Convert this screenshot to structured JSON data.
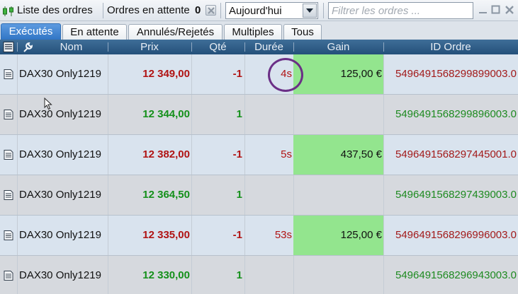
{
  "toolbar": {
    "title": "Liste des ordres",
    "pending_label": "Ordres en attente",
    "pending_count": "0",
    "period_value": "Aujourd'hui",
    "filter_placeholder": "Filtrer les ordres ..."
  },
  "tabs": [
    {
      "label": "Exécutés",
      "active": true
    },
    {
      "label": "En attente",
      "active": false
    },
    {
      "label": "Annulés/Rejetés",
      "active": false
    },
    {
      "label": "Multiples",
      "active": false
    },
    {
      "label": "Tous",
      "active": false
    }
  ],
  "columns": {
    "name": "Nom",
    "price": "Prix",
    "qty": "Qté",
    "duration": "Durée",
    "gain": "Gain",
    "order_id": "ID Ordre"
  },
  "rows": [
    {
      "name": "DAX30 Only1219",
      "price": "12 349,00",
      "qty": "-1",
      "duration": "4s",
      "gain": "125,00 €",
      "order_id": "5496491568299899003.0",
      "side": "sell"
    },
    {
      "name": "DAX30 Only1219",
      "price": "12 344,00",
      "qty": "1",
      "duration": "",
      "gain": "",
      "order_id": "5496491568299896003.0",
      "side": "buy"
    },
    {
      "name": "DAX30 Only1219",
      "price": "12 382,00",
      "qty": "-1",
      "duration": "5s",
      "gain": "437,50 €",
      "order_id": "5496491568297445001.0",
      "side": "sell"
    },
    {
      "name": "DAX30 Only1219",
      "price": "12 364,50",
      "qty": "1",
      "duration": "",
      "gain": "",
      "order_id": "5496491568297439003.0",
      "side": "buy"
    },
    {
      "name": "DAX30 Only1219",
      "price": "12 335,00",
      "qty": "-1",
      "duration": "53s",
      "gain": "125,00 €",
      "order_id": "5496491568296996003.0",
      "side": "sell"
    },
    {
      "name": "DAX30 Only1219",
      "price": "12 330,00",
      "qty": "1",
      "duration": "",
      "gain": "",
      "order_id": "5496491568296943003.0",
      "side": "buy"
    }
  ],
  "colors": {
    "sell": "#b01313",
    "buy": "#14901a",
    "gain_positive": "#93e58e",
    "header": "#2f5a84",
    "active_tab": "#3a7fcf",
    "highlight_circle": "#6b2f86"
  },
  "icons": {
    "toolbar": "candlestick-chart-icon",
    "clear": "clear-icon",
    "dropdown": "chevron-down-icon",
    "minimize": "minimize-icon",
    "maximize": "maximize-icon",
    "close": "close-icon",
    "header_doc": "document-icon",
    "header_settings": "wrench-icon",
    "row_doc": "document-icon"
  }
}
